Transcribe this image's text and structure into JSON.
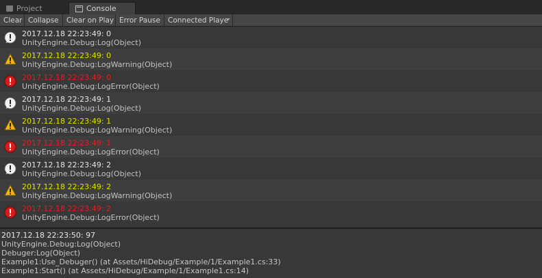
{
  "tabs": [
    {
      "label": "Project",
      "icon": "folder-icon"
    },
    {
      "label": "Console",
      "icon": "console-icon"
    }
  ],
  "toolbar": {
    "clear": "Clear",
    "collapse": "Collapse",
    "clear_on_play": "Clear on Play",
    "error_pause": "Error Pause",
    "connected_player": "Connected Playe"
  },
  "colors": {
    "info_text": "#e6e6e6",
    "warning_text": "#e0e000",
    "error_text": "#e02020",
    "panel_bg": "#383838"
  },
  "logs": [
    {
      "level": "info",
      "message": "2017.12.18 22:23:49: 0",
      "source": "UnityEngine.Debug:Log(Object)"
    },
    {
      "level": "warning",
      "message": "2017.12.18 22:23:49: 0",
      "source": "UnityEngine.Debug:LogWarning(Object)"
    },
    {
      "level": "error",
      "message": "2017.12.18 22:23:49: 0",
      "source": "UnityEngine.Debug:LogError(Object)"
    },
    {
      "level": "info",
      "message": "2017.12.18 22:23:49: 1",
      "source": "UnityEngine.Debug:Log(Object)"
    },
    {
      "level": "warning",
      "message": "2017.12.18 22:23:49: 1",
      "source": "UnityEngine.Debug:LogWarning(Object)"
    },
    {
      "level": "error",
      "message": "2017.12.18 22:23:49: 1",
      "source": "UnityEngine.Debug:LogError(Object)"
    },
    {
      "level": "info",
      "message": "2017.12.18 22:23:49: 2",
      "source": "UnityEngine.Debug:Log(Object)"
    },
    {
      "level": "warning",
      "message": "2017.12.18 22:23:49: 2",
      "source": "UnityEngine.Debug:LogWarning(Object)"
    },
    {
      "level": "error",
      "message": "2017.12.18 22:23:49: 2",
      "source": "UnityEngine.Debug:LogError(Object)"
    }
  ],
  "detail": {
    "lines": [
      "2017.12.18 22:23:50: 97",
      "UnityEngine.Debug:Log(Object)",
      "Debuger:Log(Object)",
      "Example1:Use_Debuger() (at Assets/HiDebug/Example/1/Example1.cs:33)",
      "Example1:Start() (at Assets/HiDebug/Example/1/Example1.cs:14)"
    ]
  }
}
